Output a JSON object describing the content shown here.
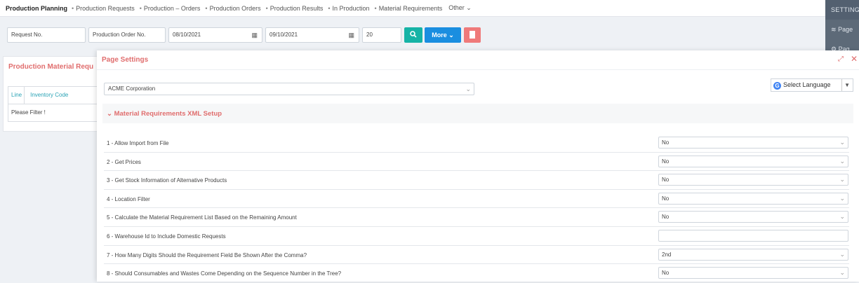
{
  "nav": {
    "brand": "Production Planning",
    "items": [
      "Production Requests",
      "Production – Orders",
      "Production Orders",
      "Production Results",
      "In Production",
      "Material Requirements"
    ],
    "other": "Other"
  },
  "settings_panel": {
    "header": "SETTING",
    "items": [
      "Page",
      "Pag"
    ]
  },
  "filters": {
    "request_no": "Request No.",
    "production_order_no": "Production Order No.",
    "date_from": "08/10/2021",
    "date_to": "09/10/2021",
    "count": "20",
    "more_label": "More"
  },
  "bg_panel": {
    "title": "Production Material Requ",
    "col_line": "Line",
    "col_inventory": "Inventory Code",
    "empty_text": "Please Filter !"
  },
  "modal": {
    "title": "Page Settings",
    "company": "ACME Corporation",
    "language": "Select Language",
    "section_title": "Material Requirements XML Setup",
    "rows": [
      {
        "label": "1 - Allow Import from File",
        "value": "No",
        "type": "select"
      },
      {
        "label": "2 - Get Prices",
        "value": "No",
        "type": "select"
      },
      {
        "label": "3 - Get Stock Information of Alternative Products",
        "value": "No",
        "type": "select"
      },
      {
        "label": "4 - Location Filter",
        "value": "No",
        "type": "select"
      },
      {
        "label": "5 - Calculate the Material Requirement List Based on the Remaining Amount",
        "value": "No",
        "type": "select"
      },
      {
        "label": "6 - Warehouse Id to Include Domestic Requests",
        "value": "",
        "type": "text"
      },
      {
        "label": "7 - How Many Digits Should the Requirement Field Be Shown After the Comma?",
        "value": "2nd",
        "type": "select"
      },
      {
        "label": "8 - Should Consumables and Wastes Come Depending on the Sequence Number in the Tree?",
        "value": "No",
        "type": "select"
      }
    ]
  },
  "colors": {
    "accent_red": "#e06d6d",
    "teal": "#16b3a6",
    "blue": "#1a8ee0",
    "sidebar": "#5d6a78"
  }
}
